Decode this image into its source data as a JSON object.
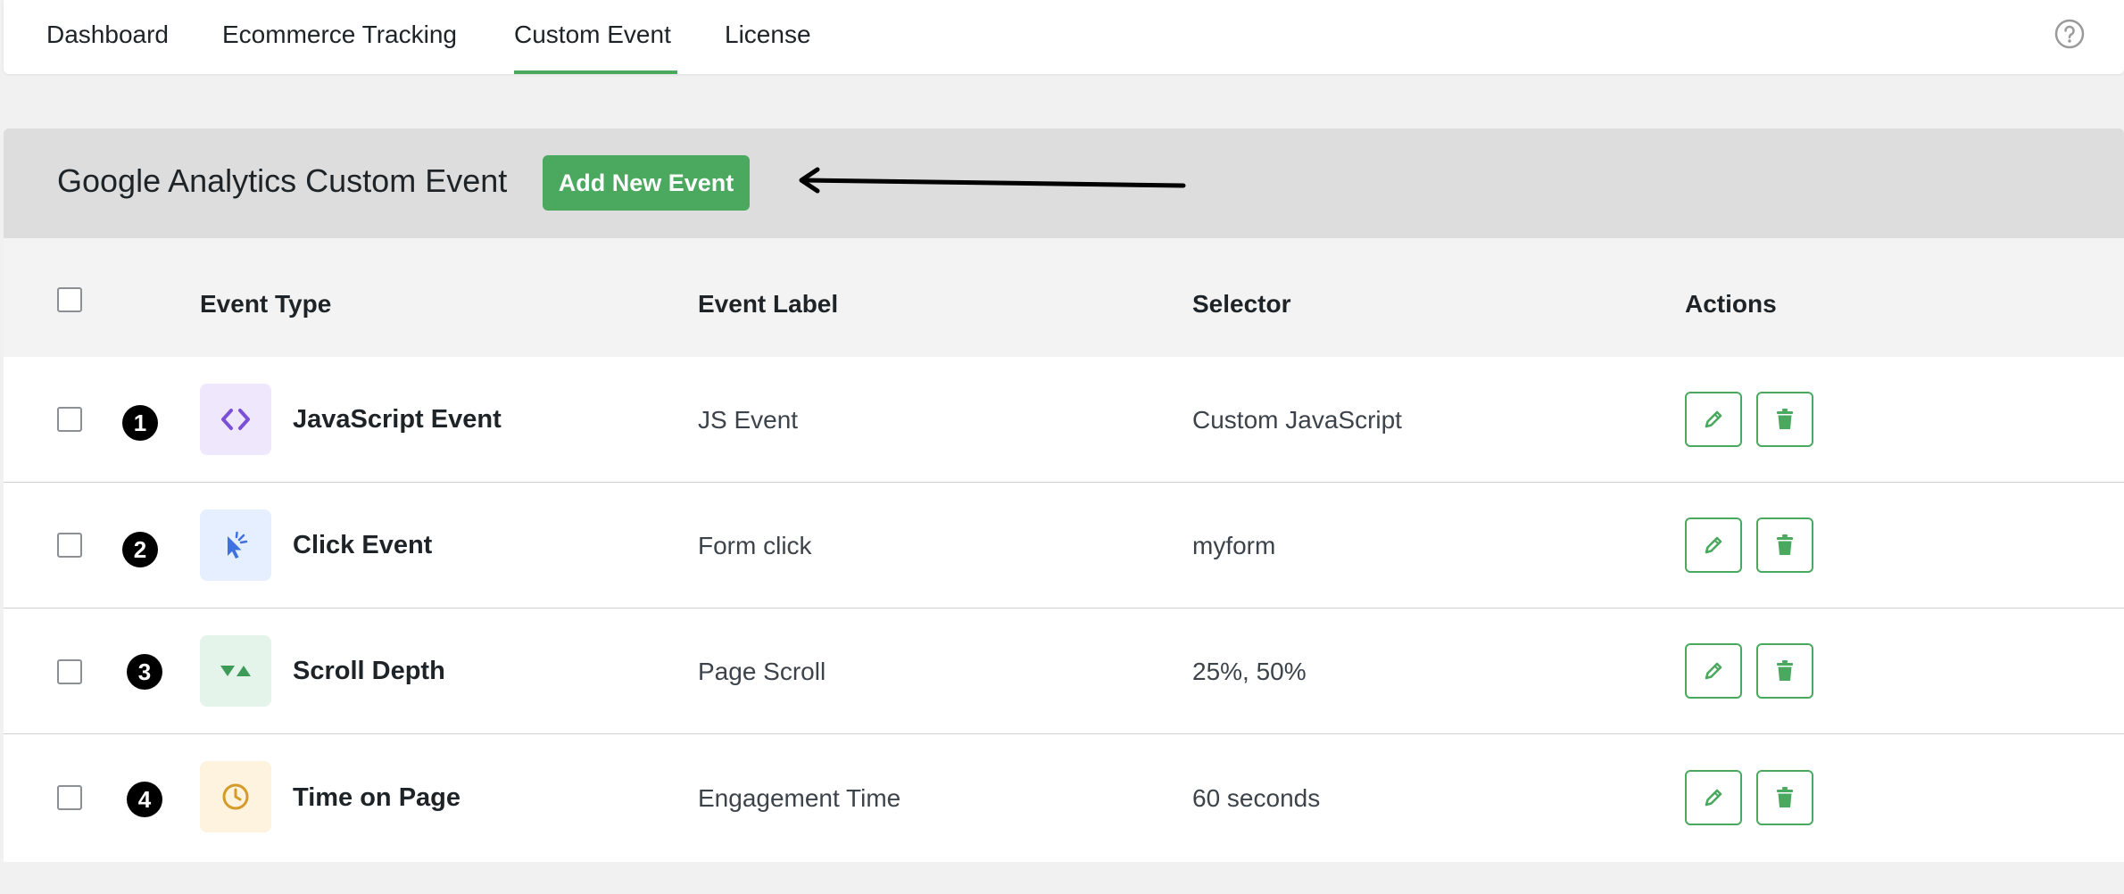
{
  "nav": {
    "tabs": [
      {
        "label": "Dashboard",
        "active": false
      },
      {
        "label": "Ecommerce Tracking",
        "active": false
      },
      {
        "label": "Custom Event",
        "active": true
      },
      {
        "label": "License",
        "active": false
      }
    ],
    "help_icon": "question-circle-icon"
  },
  "panel": {
    "title": "Google Analytics Custom Event",
    "add_button_label": "Add New Event"
  },
  "table": {
    "columns": [
      "Event Type",
      "Event Label",
      "Selector",
      "Actions"
    ],
    "rows": [
      {
        "marker": "1",
        "type": "JavaScript Event",
        "label": "JS Event",
        "selector": "Custom JavaScript",
        "icon": "code-icon",
        "icon_color": "#7b4fd6",
        "icon_bg": "#efe7fb"
      },
      {
        "marker": "2",
        "type": "Click Event",
        "label": "Form click",
        "selector": "myform",
        "icon": "cursor-click-icon",
        "icon_color": "#3f72e0",
        "icon_bg": "#e6efff"
      },
      {
        "marker": "3",
        "type": "Scroll Depth",
        "label": "Page Scroll",
        "selector": "25%, 50%",
        "icon": "scroll-triangles-icon",
        "icon_color": "#3e9a59",
        "icon_bg": "#e5f4ea"
      },
      {
        "marker": "4",
        "type": "Time on Page",
        "label": "Engagement Time",
        "selector": "60 seconds",
        "icon": "clock-icon",
        "icon_color": "#d49a2a",
        "icon_bg": "#fdf3df"
      }
    ],
    "edit_icon": "pencil-icon",
    "delete_icon": "trash-icon"
  },
  "colors": {
    "accent": "#4aa95f",
    "header_bg": "#dddddd",
    "page_bg": "#f1f1f1"
  }
}
